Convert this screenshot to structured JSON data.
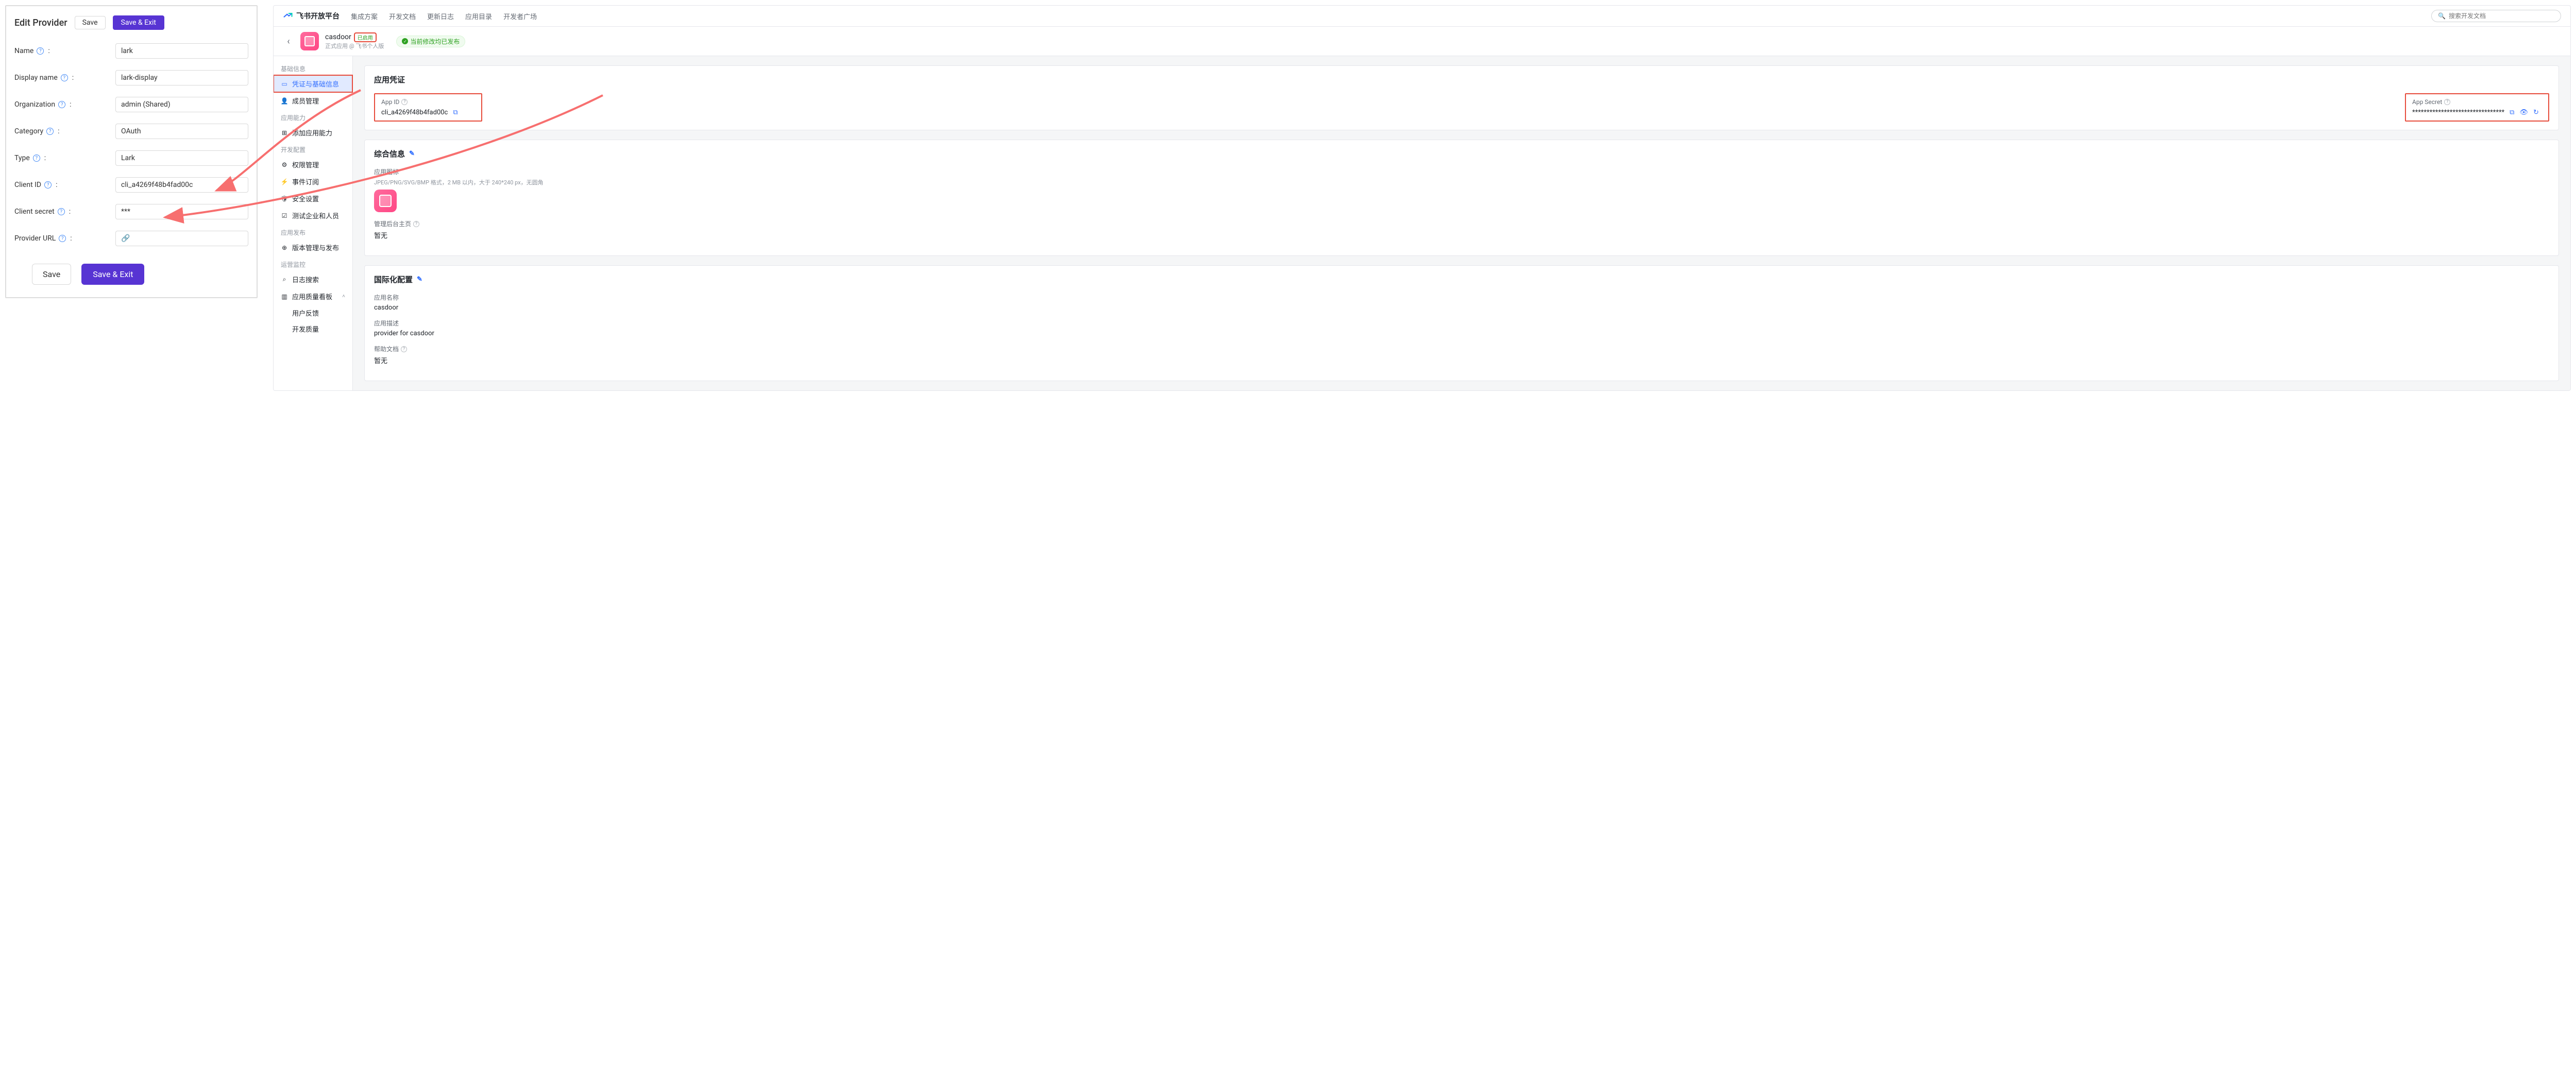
{
  "left": {
    "title": "Edit Provider",
    "save": "Save",
    "save_exit": "Save & Exit",
    "save_lg": "Save",
    "save_exit_lg": "Save & Exit",
    "fields": {
      "name": {
        "label": "Name",
        "value": "lark"
      },
      "display_name": {
        "label": "Display name",
        "value": "lark-display"
      },
      "organization": {
        "label": "Organization",
        "value": "admin (Shared)"
      },
      "category": {
        "label": "Category",
        "value": "OAuth"
      },
      "type": {
        "label": "Type",
        "value": "Lark"
      },
      "client_id": {
        "label": "Client ID",
        "value": "cli_a4269f48b4fad00c"
      },
      "client_secret": {
        "label": "Client secret",
        "value": "***"
      },
      "provider_url": {
        "label": "Provider URL",
        "value": ""
      }
    },
    "link_glyph": "🔗"
  },
  "right": {
    "brand": "飞书开放平台",
    "nav": [
      "集成方案",
      "开发文档",
      "更新日志",
      "应用目录",
      "开发者广场"
    ],
    "search_placeholder": "搜索开发文档",
    "back_glyph": "‹",
    "app": {
      "name": "casdoor",
      "badge": "已启用",
      "subtitle": "正式应用 @ 飞书个人版"
    },
    "publish_status": "当前修改均已发布",
    "sidebar": {
      "sections": [
        {
          "title": "基础信息",
          "items": [
            {
              "icon": "▭",
              "label": "凭证与基础信息",
              "active": true
            },
            {
              "icon": "👤",
              "label": "成员管理"
            }
          ]
        },
        {
          "title": "应用能力",
          "items": [
            {
              "icon": "⊞",
              "label": "添加应用能力"
            }
          ]
        },
        {
          "title": "开发配置",
          "items": [
            {
              "icon": "⚙",
              "label": "权限管理"
            },
            {
              "icon": "⚡",
              "label": "事件订阅"
            },
            {
              "icon": "🛡",
              "label": "安全设置"
            },
            {
              "icon": "☑",
              "label": "测试企业和人员"
            }
          ]
        },
        {
          "title": "应用发布",
          "items": [
            {
              "icon": "⊕",
              "label": "版本管理与发布"
            }
          ]
        },
        {
          "title": "运营监控",
          "items": [
            {
              "icon": "⌕",
              "label": "日志搜索"
            },
            {
              "icon": "▥",
              "label": "应用质量看板",
              "expanded": true,
              "children": [
                "用户反馈",
                "开发质量"
              ]
            }
          ]
        }
      ]
    },
    "cards": {
      "credentials": {
        "title": "应用凭证",
        "app_id_label": "App ID",
        "app_id_value": "cli_a4269f48b4fad00c",
        "app_secret_label": "App Secret",
        "app_secret_value": "********************************"
      },
      "summary": {
        "title": "综合信息",
        "icon_label": "应用图标",
        "icon_hint": "JPEG/PNG/SVG/BMP 格式，2 MB 以内，大于 240*240 px，无圆角",
        "admin_label": "管理后台主页",
        "admin_value": "暂无"
      },
      "i18n": {
        "title": "国际化配置",
        "name_label": "应用名称",
        "name_value": "casdoor",
        "desc_label": "应用描述",
        "desc_value": "provider for casdoor",
        "help_label": "帮助文档",
        "help_value": "暂无"
      }
    }
  }
}
